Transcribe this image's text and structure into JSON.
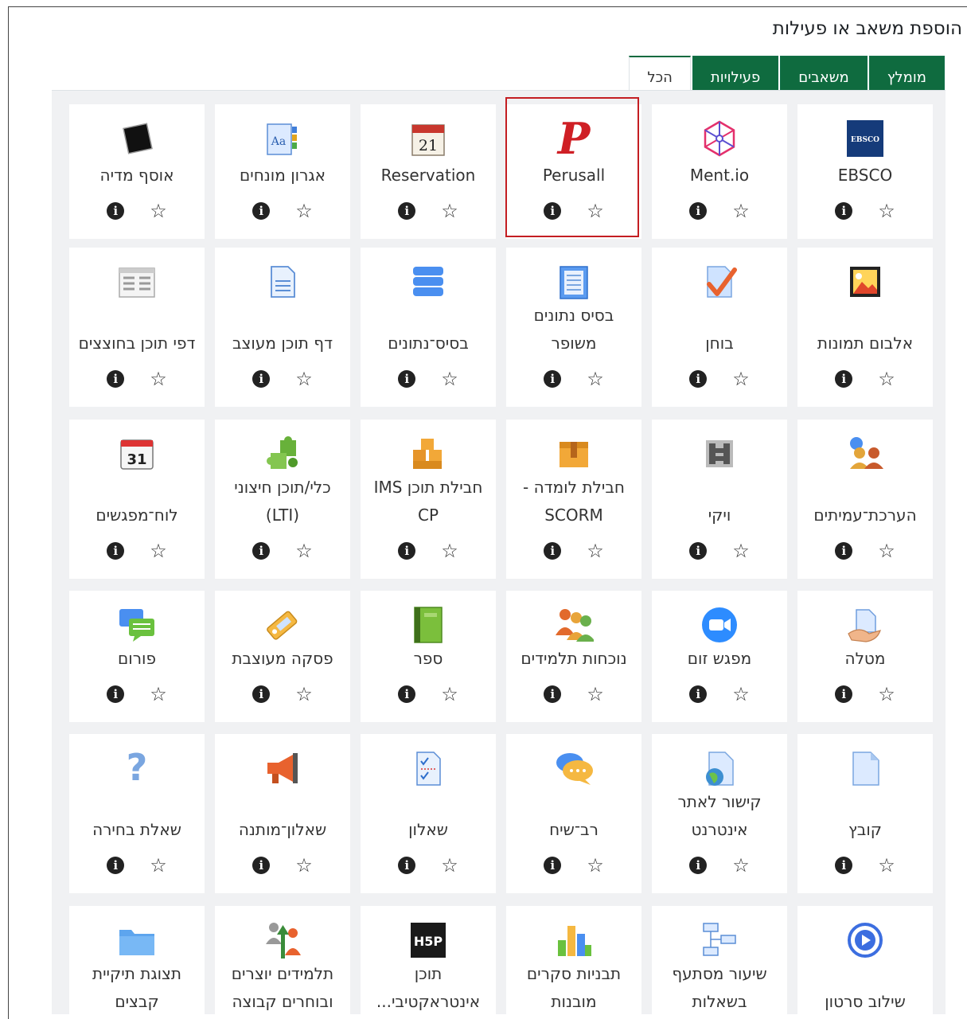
{
  "dialog": {
    "title": "הוספת משאב או פעילות"
  },
  "tabs": [
    {
      "label": "הכל",
      "active": true
    },
    {
      "label": "פעילויות",
      "active": false
    },
    {
      "label": "משאבים",
      "active": false
    },
    {
      "label": "מומלץ",
      "active": false
    }
  ],
  "colors": {
    "tab_green": "#0f6b3f",
    "highlight_red": "#c41e22",
    "panel_bg": "#f0f1f3"
  },
  "rows": [
    [
      {
        "lines": [
          "EBSCO"
        ],
        "icon": "ebsco-icon"
      },
      {
        "lines": [
          "Ment.io"
        ],
        "icon": "mentio-icon"
      },
      {
        "lines": [
          "Perusall"
        ],
        "icon": "perusall-icon",
        "highlighted": true
      },
      {
        "lines": [
          "Reservation"
        ],
        "icon": "calendar-21-icon"
      },
      {
        "lines": [
          "אגרון מונחים"
        ],
        "icon": "glossary-icon"
      },
      {
        "lines": [
          "אוסף מדיה"
        ],
        "icon": "media-collection-icon"
      }
    ],
    [
      {
        "lines": [
          "אלבום תמונות"
        ],
        "icon": "image-album-icon"
      },
      {
        "lines": [
          "בוחן"
        ],
        "icon": "quiz-check-icon"
      },
      {
        "lines": [
          "בסיס נתונים",
          "משופר"
        ],
        "icon": "enhanced-database-icon"
      },
      {
        "lines": [
          "בסיס־נתונים"
        ],
        "icon": "database-icon"
      },
      {
        "lines": [
          "דף תוכן מעוצב"
        ],
        "icon": "page-icon"
      },
      {
        "lines": [
          "דפי תוכן בחוצצים"
        ],
        "icon": "tabbed-pages-icon"
      }
    ],
    [
      {
        "lines": [
          "הערכת־עמיתים"
        ],
        "icon": "peer-assessment-icon"
      },
      {
        "lines": [
          "ויקי"
        ],
        "icon": "wiki-icon"
      },
      {
        "lines": [
          "חבילת לומדה -",
          "SCORM"
        ],
        "icon": "scorm-package-icon"
      },
      {
        "lines": [
          "חבילת תוכן IMS",
          "CP"
        ],
        "icon": "ims-package-icon"
      },
      {
        "lines": [
          "כלי/תוכן חיצוני",
          "(LTI)"
        ],
        "icon": "puzzle-icon"
      },
      {
        "lines": [
          "לוח־מפגשים"
        ],
        "icon": "calendar-31-icon"
      }
    ],
    [
      {
        "lines": [
          "מטלה"
        ],
        "icon": "assignment-icon"
      },
      {
        "lines": [
          "מפגש זום"
        ],
        "icon": "zoom-icon"
      },
      {
        "lines": [
          "נוכחות תלמידים"
        ],
        "icon": "attendance-icon"
      },
      {
        "lines": [
          "ספר"
        ],
        "icon": "book-icon"
      },
      {
        "lines": [
          "פסקה מעוצבת"
        ],
        "icon": "label-tag-icon"
      },
      {
        "lines": [
          "פורום"
        ],
        "icon": "forum-icon"
      }
    ],
    [
      {
        "lines": [
          "קובץ"
        ],
        "icon": "file-icon"
      },
      {
        "lines": [
          "קישור לאתר",
          "אינטרנט"
        ],
        "icon": "url-icon"
      },
      {
        "lines": [
          "רב־שיח"
        ],
        "icon": "chat-icon"
      },
      {
        "lines": [
          "שאלון"
        ],
        "icon": "questionnaire-icon"
      },
      {
        "lines": [
          "שאלון־מותנה"
        ],
        "icon": "feedback-megaphone-icon"
      },
      {
        "lines": [
          "שאלת בחירה"
        ],
        "icon": "choice-question-icon"
      }
    ],
    [
      {
        "lines": [
          "שילוב סרטון"
        ],
        "icon": "video-embed-icon"
      },
      {
        "lines": [
          "שיעור מסתעף",
          "בשאלות"
        ],
        "icon": "lesson-icon"
      },
      {
        "lines": [
          "תבניות סקרים",
          "מובנות"
        ],
        "icon": "survey-chart-icon"
      },
      {
        "lines": [
          "תוכן",
          "אינטראקטיבי..."
        ],
        "icon": "h5p-icon"
      },
      {
        "lines": [
          "תלמידים יוצרים",
          "ובוחרים קבוצה"
        ],
        "icon": "group-choice-icon"
      },
      {
        "lines": [
          "תצוגת תיקיית",
          "קבצים"
        ],
        "icon": "folder-icon"
      }
    ]
  ],
  "action_icons": {
    "info": "info-icon",
    "star": "star-outline-icon"
  },
  "info_glyph": "i",
  "star_glyph": "☆"
}
